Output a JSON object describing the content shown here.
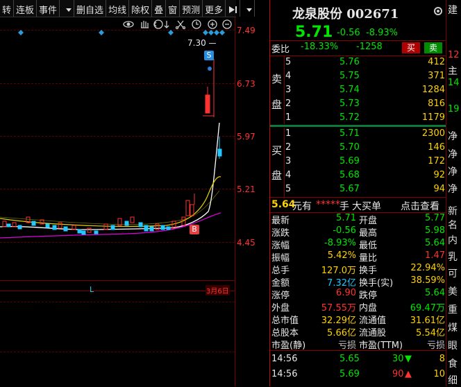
{
  "toolbar": {
    "items": [
      "转",
      "连板",
      "事件",
      "",
      "删自选",
      "均线",
      "除权",
      "叠",
      "窗",
      "预测",
      "更多"
    ]
  },
  "chart": {
    "price_labels": [
      "7.49",
      "6.73",
      "5.97",
      "5.21",
      "4.45"
    ],
    "high_annotation": "7.30",
    "sell_marker": "S",
    "buy_marker": "B",
    "x_marker": "L",
    "date_tag": "3月6日"
  },
  "stock": {
    "name": "龙泉股份",
    "code": "002671",
    "price": "5.71",
    "change": "-0.56",
    "change_pct": "-8.93%"
  },
  "weibi": {
    "label": "委比",
    "pct": "-18.33%",
    "diff": "-1258",
    "buy_btn": "买",
    "sell_btn": "卖"
  },
  "asks": [
    {
      "level": "5",
      "price": "5.76",
      "vol": "412"
    },
    {
      "level": "4",
      "price": "5.75",
      "vol": "371"
    },
    {
      "level": "3",
      "price": "5.74",
      "vol": "1284"
    },
    {
      "level": "2",
      "price": "5.73",
      "vol": "816"
    },
    {
      "level": "1",
      "price": "5.72",
      "vol": "1179"
    }
  ],
  "bids": [
    {
      "level": "1",
      "price": "5.71",
      "vol": "2300"
    },
    {
      "level": "2",
      "price": "5.70",
      "vol": "146"
    },
    {
      "level": "3",
      "price": "5.69",
      "vol": "172"
    },
    {
      "level": "4",
      "price": "5.68",
      "vol": "92"
    },
    {
      "level": "5",
      "price": "5.67",
      "vol": "94"
    }
  ],
  "side_labels": {
    "sell_a": "卖",
    "sell_b": "盘",
    "buy_a": "买",
    "buy_b": "盘"
  },
  "big_order": {
    "price": "5.64",
    "unit": "元有",
    "stars": "*****",
    "hand": "手",
    "type": "大买单",
    "action": "点击查看"
  },
  "quote": [
    {
      "l1": "最新",
      "v1": "5.71",
      "c1": "green",
      "l2": "开盘",
      "v2": "5.77",
      "c2": "green"
    },
    {
      "l1": "涨跌",
      "v1": "-0.56",
      "c1": "green",
      "l2": "最高",
      "v2": "5.98",
      "c2": "green"
    },
    {
      "l1": "涨幅",
      "v1": "-8.93%",
      "c1": "green",
      "l2": "最低",
      "v2": "5.64",
      "c2": "green"
    },
    {
      "l1": "振幅",
      "v1": "5.42%",
      "c1": "yellow",
      "l2": "量比",
      "v2": "1.47",
      "c2": "red"
    },
    {
      "l1": "总手",
      "v1": "127.0万",
      "c1": "yellow",
      "l2": "换手",
      "v2": "22.94%",
      "c2": "yellow"
    },
    {
      "l1": "金额",
      "v1": "7.32亿",
      "c1": "cyan",
      "l2": "换手(实)",
      "v2": "38.59%",
      "c2": "yellow"
    },
    {
      "l1": "涨停",
      "v1": "6.90",
      "c1": "red",
      "l2": "跌停",
      "v2": "5.64",
      "c2": "green"
    },
    {
      "l1": "外盘",
      "v1": "57.55万",
      "c1": "red",
      "l2": "内盘",
      "v2": "69.47万",
      "c2": "green"
    },
    {
      "l1": "总市值",
      "v1": "32.29亿",
      "c1": "yellow",
      "l2": "流通值",
      "v2": "31.61亿",
      "c2": "yellow"
    },
    {
      "l1": "总股本",
      "v1": "5.66亿",
      "c1": "yellow",
      "l2": "流通股",
      "v2": "5.54亿",
      "c2": "yellow"
    },
    {
      "l1": "市盈(静)",
      "v1": "亏损",
      "c1": "gray",
      "l2": "市盈(TTM)",
      "v2": "亏损",
      "c2": "gray"
    }
  ],
  "ticks": [
    {
      "time": "14:56",
      "price": "5.65",
      "vol": "30",
      "dir": "down",
      "num": "8"
    },
    {
      "time": "14:56",
      "price": "5.69",
      "vol": "90",
      "dir": "up",
      "num": "10"
    }
  ],
  "edge": {
    "items": [
      "建",
      "12",
      "主",
      "14",
      "19",
      "净",
      "净",
      "净",
      "净",
      "新",
      "名",
      "内",
      "乳",
      "可",
      "美",
      "重",
      "煤",
      "眼",
      "食",
      "细"
    ]
  }
}
